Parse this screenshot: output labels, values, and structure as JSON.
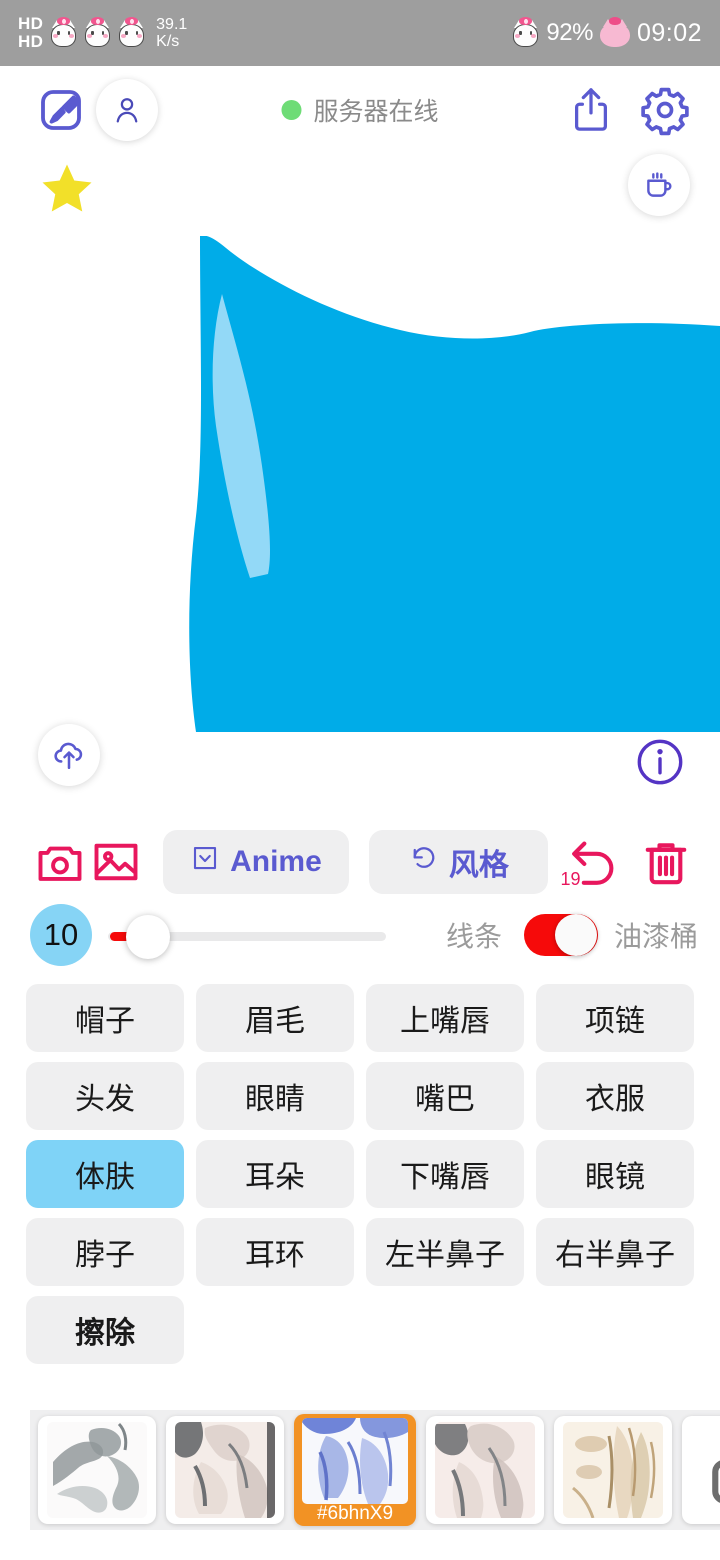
{
  "statusbar": {
    "hd_primary": "HD",
    "hd_secondary": "HD",
    "network_speed_value": "39.1",
    "network_speed_unit": "K/s",
    "battery": "92%",
    "time": "09:02",
    "icons": [
      "cat-face-icon",
      "cat-face-icon",
      "cat-face-icon",
      "cat-face-icon",
      "pink-cat-icon"
    ]
  },
  "header": {
    "brush_icon": "brush-square-icon",
    "profile_icon": "person-icon",
    "server_status_text": "服务器在线",
    "server_status_color": "#6edc76",
    "share_icon": "share-upload-icon",
    "settings_icon": "gear-icon",
    "star_icon": "star-icon",
    "star_color": "#f2e029",
    "coffee_icon": "coffee-cup-icon"
  },
  "canvas": {
    "fill_color": "#00ace8",
    "highlight_color": "#93d9f7",
    "background": "#ffffff",
    "cloud_upload_icon": "cloud-upload-icon",
    "info_icon": "info-circle-icon",
    "accent_purple": "#5a5ad0"
  },
  "toolbar": {
    "camera_icon": "camera-icon",
    "gallery_icon": "image-gallery-icon",
    "anime_label": "Anime",
    "anime_icon": "chevron-down-box-icon",
    "style_label": "风格",
    "style_icon": "refresh-ccw-icon",
    "undo_icon": "undo-arrow-icon",
    "undo_count": "19",
    "delete_icon": "trash-icon",
    "accent_red": "#e8175d",
    "accent_purple": "#5a5ad0"
  },
  "brush": {
    "size_value": "10",
    "size_badge_color": "#86d4f5",
    "slider_fill_color": "#f60a0a",
    "left_mode_label": "线条",
    "right_mode_label": "油漆桶",
    "toggle_on": true,
    "toggle_color": "#f60a0a"
  },
  "parts": {
    "selected": "体肤",
    "selected_color": "#7fd3f7",
    "items": [
      {
        "label": "帽子",
        "selected": false,
        "bold": false
      },
      {
        "label": "眉毛",
        "selected": false,
        "bold": false
      },
      {
        "label": "上嘴唇",
        "selected": false,
        "bold": false
      },
      {
        "label": "项链",
        "selected": false,
        "bold": false
      },
      {
        "label": "头发",
        "selected": false,
        "bold": false
      },
      {
        "label": "眼睛",
        "selected": false,
        "bold": false
      },
      {
        "label": "嘴巴",
        "selected": false,
        "bold": false
      },
      {
        "label": "衣服",
        "selected": false,
        "bold": false
      },
      {
        "label": "体肤",
        "selected": true,
        "bold": false
      },
      {
        "label": "耳朵",
        "selected": false,
        "bold": false
      },
      {
        "label": "下嘴唇",
        "selected": false,
        "bold": false
      },
      {
        "label": "眼镜",
        "selected": false,
        "bold": false
      },
      {
        "label": "脖子",
        "selected": false,
        "bold": false
      },
      {
        "label": "耳环",
        "selected": false,
        "bold": false
      },
      {
        "label": "左半鼻子",
        "selected": false,
        "bold": false
      },
      {
        "label": "右半鼻子",
        "selected": false,
        "bold": false
      },
      {
        "label": "擦除",
        "selected": false,
        "bold": true
      }
    ]
  },
  "thumbnails": {
    "selected_index": 2,
    "selected_tag": "#6bhnX9",
    "selected_border_color": "#f29224",
    "items": [
      {
        "name": "thumbnail-1",
        "tone": "gray"
      },
      {
        "name": "thumbnail-2",
        "tone": "warm-gray"
      },
      {
        "name": "thumbnail-3",
        "tone": "blue",
        "tag": "#6bhnX9"
      },
      {
        "name": "thumbnail-4",
        "tone": "pink-gray"
      },
      {
        "name": "thumbnail-5",
        "tone": "tan"
      }
    ],
    "lock_icon": "lock-icon"
  }
}
